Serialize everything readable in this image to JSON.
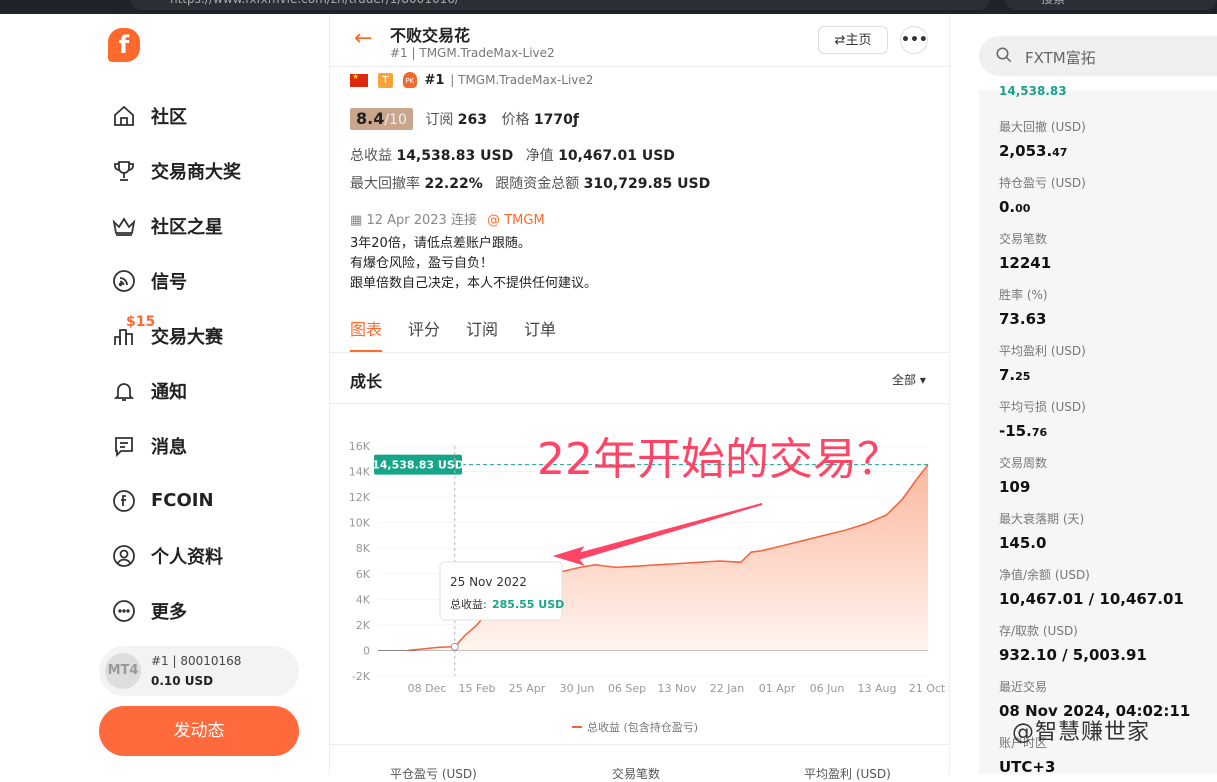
{
  "browser": {
    "url": "https://www.fxfxmvie.com/zh/trader/1/8001016/",
    "search_placeholder": "搜索"
  },
  "sidebar": {
    "logo_letter": "f",
    "items": [
      {
        "label": "社区",
        "icon": "home-icon"
      },
      {
        "label": "交易商大奖",
        "icon": "trophy-icon"
      },
      {
        "label": "社区之星",
        "icon": "crown-icon"
      },
      {
        "label": "信号",
        "icon": "signal-icon"
      },
      {
        "label": "交易大赛",
        "icon": "contest-icon",
        "badge": "$15"
      },
      {
        "label": "通知",
        "icon": "bell-icon"
      },
      {
        "label": "消息",
        "icon": "message-icon"
      },
      {
        "label": "FCOIN",
        "icon": "coin-icon"
      },
      {
        "label": "个人资料",
        "icon": "user-icon"
      },
      {
        "label": "更多",
        "icon": "more-icon"
      }
    ],
    "account": {
      "platform": "MT4",
      "rank_line": "#1 | 80010168",
      "balance": "0.10 USD"
    },
    "post_button": "发动态"
  },
  "header": {
    "back": "←",
    "title": "不败交易花",
    "subtitle": "#1 | TMGM.TradeMax-Live2",
    "home_button": "⇄主页",
    "more_button": "•••"
  },
  "profile": {
    "t_badge": "T",
    "pk_badge": "PK",
    "rank": "#1",
    "server": "| TMGM.TradeMax-Live2",
    "score": "8.4",
    "score_max": "/10",
    "subscribe_label": "订阅",
    "subscribe_count": "263",
    "price_label": "价格",
    "price_value": "1770",
    "price_unit": "ƒ",
    "total_profit_label": "总收益",
    "total_profit_value": "14,538.83 USD",
    "equity_label": "净值",
    "equity_value": "10,467.01 USD",
    "max_dd_label": "最大回撤率",
    "max_dd_value": "22.22%",
    "follow_label": "跟随资金总额",
    "follow_value": "310,729.85 USD",
    "connect_date": "12 Apr 2023 连接",
    "broker": "@ TMGM",
    "desc": [
      "3年20倍，请低点差账户跟随。",
      "有爆仓风险，盈亏自负！",
      "跟单倍数自己决定，本人不提供任何建议。"
    ]
  },
  "tabs": [
    "图表",
    "评分",
    "订阅",
    "订单"
  ],
  "chart_section": {
    "title": "成长",
    "range": "全部 ▾"
  },
  "chart_data": {
    "type": "area",
    "ylabel": "",
    "ylim": [
      -2000,
      16000
    ],
    "yticks": [
      "16K",
      "14K",
      "12K",
      "10K",
      "8K",
      "6K",
      "4K",
      "2K",
      "0",
      "-2K"
    ],
    "xticks": [
      "08 Dec",
      "15 Feb",
      "25 Apr",
      "30 Jun",
      "06 Sep",
      "13 Nov",
      "22 Jan",
      "01 Apr",
      "06 Jun",
      "13 Aug",
      "21 Oct"
    ],
    "series": [
      {
        "name": "总收益 (包含持仓盈亏)",
        "points": [
          [
            0,
            0
          ],
          [
            0.03,
            120
          ],
          [
            0.06,
            250
          ],
          [
            0.09,
            285
          ],
          [
            0.11,
            1200
          ],
          [
            0.13,
            1900
          ],
          [
            0.15,
            2800
          ],
          [
            0.17,
            3600
          ],
          [
            0.19,
            4300
          ],
          [
            0.21,
            4900
          ],
          [
            0.23,
            5400
          ],
          [
            0.25,
            5800
          ],
          [
            0.27,
            6000
          ],
          [
            0.3,
            6200
          ],
          [
            0.33,
            6500
          ],
          [
            0.36,
            6700
          ],
          [
            0.4,
            6500
          ],
          [
            0.44,
            6600
          ],
          [
            0.48,
            6700
          ],
          [
            0.52,
            6800
          ],
          [
            0.56,
            6900
          ],
          [
            0.6,
            7000
          ],
          [
            0.64,
            6900
          ],
          [
            0.66,
            7700
          ],
          [
            0.68,
            7800
          ],
          [
            0.72,
            8200
          ],
          [
            0.76,
            8600
          ],
          [
            0.8,
            9000
          ],
          [
            0.84,
            9400
          ],
          [
            0.88,
            9900
          ],
          [
            0.92,
            10600
          ],
          [
            0.95,
            11800
          ],
          [
            0.98,
            13500
          ],
          [
            1.0,
            14538.83
          ]
        ]
      }
    ],
    "current_label": "14,538.83 USD",
    "tooltip": {
      "date": "25 Nov 2022",
      "label": "总收益:",
      "value": "285.55 USD"
    },
    "annotation": "22年开始的交易？",
    "legend": "总收益 (包含持仓盈亏)",
    "colors": {
      "line": "#f4613a",
      "fill_top": "#fcb9a0",
      "fill_bottom": "#fff4ef",
      "current": "#17a589",
      "annotation": "#ff4466"
    }
  },
  "stats_footer": [
    "平仓盈亏 (USD)",
    "交易笔数",
    "平均盈利 (USD)"
  ],
  "right_search": {
    "placeholder": "FXTM富拓"
  },
  "right_stats": {
    "partial_top": "14,538.83",
    "items": [
      {
        "label": "最大回撤 (USD)",
        "value": "2,053.",
        "small": "47"
      },
      {
        "label": "持仓盈亏 (USD)",
        "value": "0.",
        "small": "00"
      },
      {
        "label": "交易笔数",
        "value": "12241",
        "small": ""
      },
      {
        "label": "胜率 (%)",
        "value": "73.63",
        "small": ""
      },
      {
        "label": "平均盈利 (USD)",
        "value": "7.",
        "small": "25"
      },
      {
        "label": "平均亏损 (USD)",
        "value": "-15.",
        "small": "76"
      },
      {
        "label": "交易周数",
        "value": "109",
        "small": ""
      },
      {
        "label": "最大衰落期 (天)",
        "value": "145.0",
        "small": ""
      },
      {
        "label": "净值/余额 (USD)",
        "value": "10,467.01 / 10,467.01",
        "small": ""
      },
      {
        "label": "存/取款 (USD)",
        "value": "932.10 / 5,003.91",
        "small": ""
      },
      {
        "label": "最近交易",
        "value": "08 Nov 2024, 04:02:11",
        "small": ""
      },
      {
        "label": "账户时区",
        "value": "UTC+3",
        "small": ""
      }
    ]
  },
  "watermark": "@智慧赚世家"
}
